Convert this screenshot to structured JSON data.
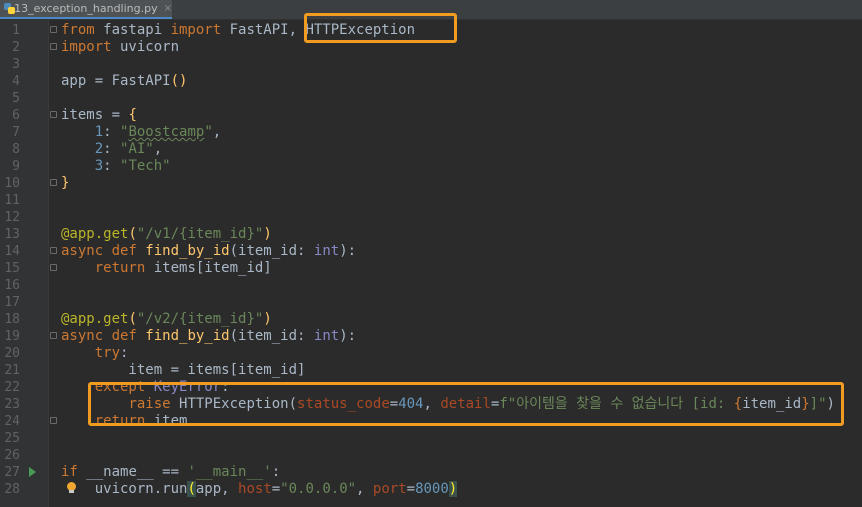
{
  "tab": {
    "filename": "13_exception_handling.py",
    "close": "×"
  },
  "lines": [
    {
      "n": "1",
      "tokens": [
        {
          "t": "from",
          "c": "kw"
        },
        {
          "t": " fastapi "
        },
        {
          "t": "import",
          "c": "kw"
        },
        {
          "t": " FastAPI, HTTPException"
        }
      ]
    },
    {
      "n": "2",
      "tokens": [
        {
          "t": "import",
          "c": "kw"
        },
        {
          "t": " uvicorn"
        }
      ]
    },
    {
      "n": "3",
      "tokens": []
    },
    {
      "n": "4",
      "tokens": [
        {
          "t": "app = FastAPI"
        },
        {
          "t": "()",
          "c": "fn"
        }
      ]
    },
    {
      "n": "5",
      "tokens": []
    },
    {
      "n": "6",
      "tokens": [
        {
          "t": "items = "
        },
        {
          "t": "{",
          "c": "fn"
        }
      ]
    },
    {
      "n": "7",
      "tokens": [
        {
          "t": "    "
        },
        {
          "t": "1",
          "c": "num"
        },
        {
          "t": ": "
        },
        {
          "t": "\"",
          "c": "str"
        },
        {
          "t": "Boostcamp",
          "c": "str typo"
        },
        {
          "t": "\"",
          "c": "str"
        },
        {
          "t": ","
        }
      ]
    },
    {
      "n": "8",
      "tokens": [
        {
          "t": "    "
        },
        {
          "t": "2",
          "c": "num"
        },
        {
          "t": ": "
        },
        {
          "t": "\"AI\"",
          "c": "str"
        },
        {
          "t": ","
        }
      ]
    },
    {
      "n": "9",
      "tokens": [
        {
          "t": "    "
        },
        {
          "t": "3",
          "c": "num"
        },
        {
          "t": ": "
        },
        {
          "t": "\"Tech\"",
          "c": "str"
        }
      ]
    },
    {
      "n": "10",
      "tokens": [
        {
          "t": "}",
          "c": "fn"
        }
      ]
    },
    {
      "n": "11",
      "tokens": []
    },
    {
      "n": "12",
      "tokens": []
    },
    {
      "n": "13",
      "tokens": [
        {
          "t": "@app.get",
          "c": "dec"
        },
        {
          "t": "(",
          "c": "fn"
        },
        {
          "t": "\"/v1/{item_id}\"",
          "c": "str"
        },
        {
          "t": ")",
          "c": "fn"
        }
      ]
    },
    {
      "n": "14",
      "tokens": [
        {
          "t": "async def ",
          "c": "kw"
        },
        {
          "t": "find_by_id",
          "c": "fn"
        },
        {
          "t": "(item_id: "
        },
        {
          "t": "int",
          "c": "bt"
        },
        {
          "t": "):"
        }
      ]
    },
    {
      "n": "15",
      "tokens": [
        {
          "t": "    "
        },
        {
          "t": "return",
          "c": "kw"
        },
        {
          "t": " items[item_id]"
        }
      ]
    },
    {
      "n": "16",
      "tokens": []
    },
    {
      "n": "17",
      "tokens": []
    },
    {
      "n": "18",
      "tokens": [
        {
          "t": "@app.get",
          "c": "dec"
        },
        {
          "t": "(",
          "c": "fn"
        },
        {
          "t": "\"/v2/{item_id}\"",
          "c": "str"
        },
        {
          "t": ")",
          "c": "fn"
        }
      ]
    },
    {
      "n": "19",
      "tokens": [
        {
          "t": "async def ",
          "c": "kw"
        },
        {
          "t": "find_by_id",
          "c": "fn"
        },
        {
          "t": "(item_id: "
        },
        {
          "t": "int",
          "c": "bt"
        },
        {
          "t": "):"
        }
      ]
    },
    {
      "n": "20",
      "tokens": [
        {
          "t": "    "
        },
        {
          "t": "try",
          "c": "kw"
        },
        {
          "t": ":"
        }
      ]
    },
    {
      "n": "21",
      "tokens": [
        {
          "t": "        item = items[item_id]"
        }
      ]
    },
    {
      "n": "22",
      "tokens": [
        {
          "t": "    "
        },
        {
          "t": "except ",
          "c": "kw"
        },
        {
          "t": "KeyError",
          "c": "bt"
        },
        {
          "t": ":"
        }
      ]
    },
    {
      "n": "23",
      "tokens": [
        {
          "t": "        "
        },
        {
          "t": "raise ",
          "c": "kw"
        },
        {
          "t": "HTTPException("
        },
        {
          "t": "status_code",
          "c": "par"
        },
        {
          "t": "="
        },
        {
          "t": "404",
          "c": "num"
        },
        {
          "t": ", "
        },
        {
          "t": "detail",
          "c": "par"
        },
        {
          "t": "="
        },
        {
          "t": "f\"아이템을 찾을 수 없습니다 [id: ",
          "c": "str"
        },
        {
          "t": "{",
          "c": "kw"
        },
        {
          "t": "item_id"
        },
        {
          "t": "}",
          "c": "kw"
        },
        {
          "t": "]\"",
          "c": "str"
        },
        {
          "t": ")"
        }
      ]
    },
    {
      "n": "24",
      "tokens": [
        {
          "t": "    "
        },
        {
          "t": "return",
          "c": "kw"
        },
        {
          "t": " item"
        }
      ]
    },
    {
      "n": "25",
      "tokens": []
    },
    {
      "n": "26",
      "tokens": []
    },
    {
      "n": "27",
      "tokens": [
        {
          "t": "if ",
          "c": "kw"
        },
        {
          "t": "__name__ == "
        },
        {
          "t": "'__main__'",
          "c": "str"
        },
        {
          "t": ":"
        }
      ]
    },
    {
      "n": "28",
      "tokens": [
        {
          "t": "    uvicorn.run"
        },
        {
          "t": "(",
          "c": "hlbrace"
        },
        {
          "t": "app, "
        },
        {
          "t": "host",
          "c": "par"
        },
        {
          "t": "="
        },
        {
          "t": "\"0.0.0.0\"",
          "c": "str"
        },
        {
          "t": ", "
        },
        {
          "t": "port",
          "c": "par"
        },
        {
          "t": "="
        },
        {
          "t": "8000",
          "c": "num"
        },
        {
          "t": ")",
          "c": "hlbrace"
        }
      ]
    }
  ],
  "colors": {
    "highlight_box": "#f29b21",
    "background": "#2b2b2b"
  }
}
